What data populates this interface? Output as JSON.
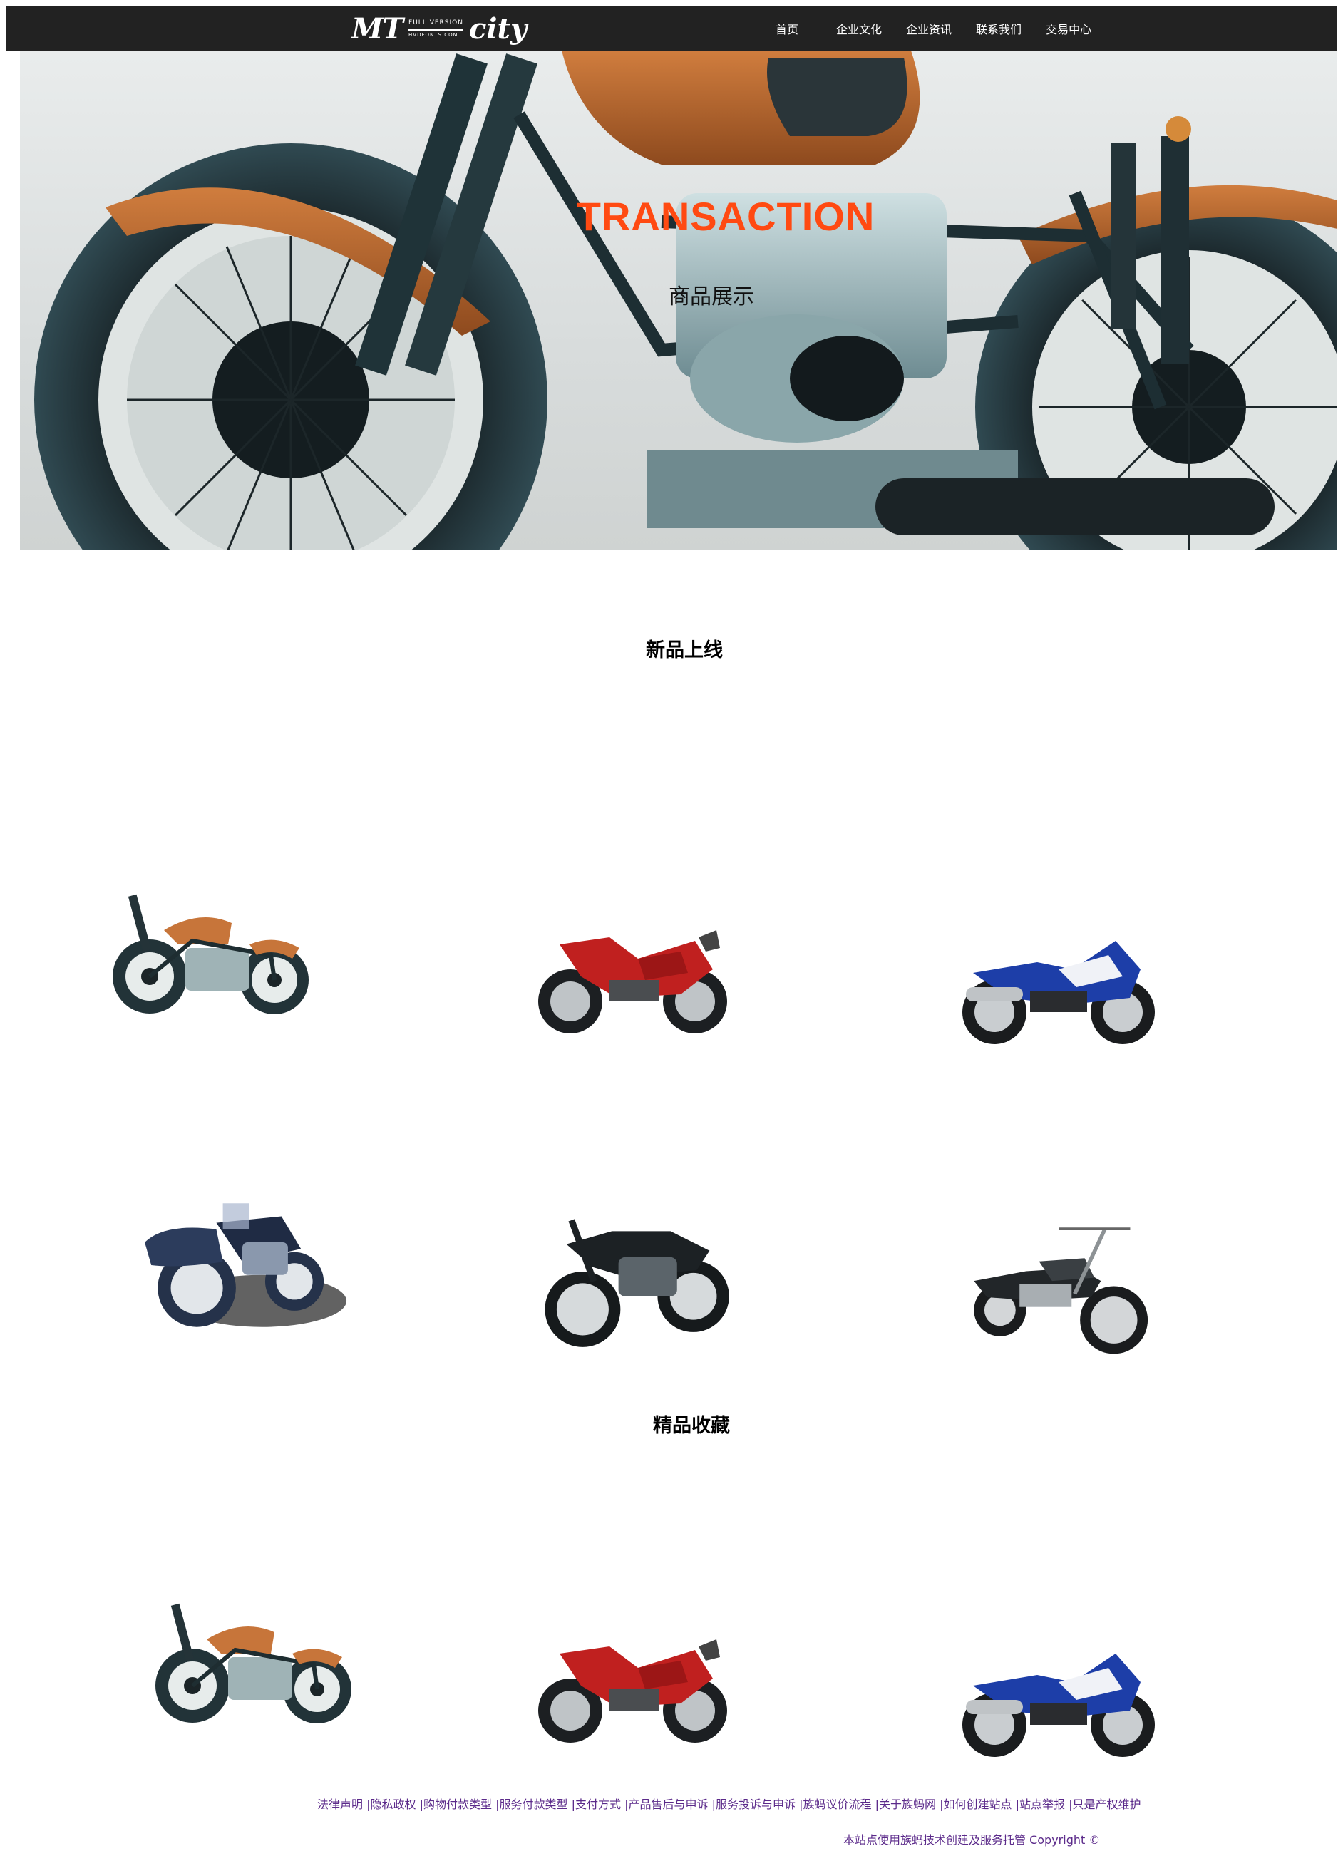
{
  "header": {
    "logo": {
      "main": "MT",
      "line1": "FULL VERSION",
      "line2": "HVDFONTS.COM",
      "city": "city"
    },
    "nav": [
      "首页",
      "企业文化",
      "企业资讯",
      "联系我们",
      "交易中心"
    ]
  },
  "hero": {
    "title": "TRANSACTION",
    "subtitle": "商品展示"
  },
  "sections": {
    "new": "新品上线",
    "featured": "精品收藏"
  },
  "products": {
    "new_row1": [
      "cafe-racer-copper",
      "red-sportbike",
      "blue-sportbike"
    ],
    "new_row2": [
      "sidecar-motorcycle",
      "black-custom-bike",
      "cruiser-motorcycle"
    ],
    "featured_row1": [
      "cafe-racer-copper",
      "red-sportbike",
      "blue-sportbike"
    ]
  },
  "footer": {
    "links": [
      "法律声明",
      "隐私政权",
      "购物付款类型",
      "服务付款类型",
      "支付方式",
      "产品售后与申诉",
      "服务投诉与申诉",
      "族蚂议价流程",
      "关于族蚂网",
      "如何创建站点",
      "站点举报",
      "只是产权维护"
    ],
    "copyright": "本站点使用族蚂技术创建及服务托管 Copyright ©"
  },
  "colors": {
    "nav_bg": "#222222",
    "hero_title": "#ff4a12",
    "footer_link": "#5b2a8a"
  }
}
